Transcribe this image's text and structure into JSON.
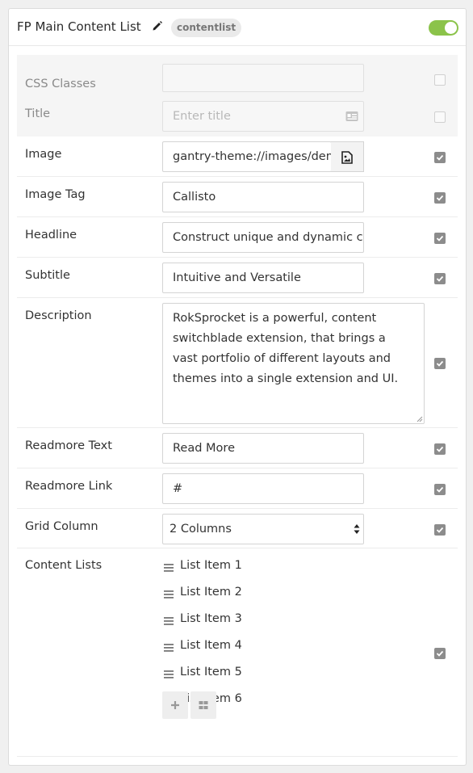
{
  "panel": {
    "title": "FP Main Content List",
    "badge": "contentlist",
    "enabled": true,
    "accent_color": "#8bc34a"
  },
  "fields": {
    "css_classes": {
      "label": "CSS Classes",
      "value": "",
      "checked": false
    },
    "title": {
      "label": "Title",
      "placeholder": "Enter title",
      "checked": false
    },
    "image": {
      "label": "Image",
      "value": "gantry-theme://images/demo/",
      "checked": true
    },
    "image_tag": {
      "label": "Image Tag",
      "value": "Callisto",
      "checked": true
    },
    "headline": {
      "label": "Headline",
      "value": "Construct unique and dynamic content",
      "checked": true
    },
    "subtitle": {
      "label": "Subtitle",
      "value": "Intuitive and Versatile",
      "checked": true
    },
    "description": {
      "label": "Description",
      "value": "RokSprocket is a powerful, content switchblade extension, that brings a vast portfolio of different layouts and themes into a single extension and UI.",
      "checked": true
    },
    "readmore_text": {
      "label": "Readmore Text",
      "value": "Read More",
      "checked": true
    },
    "readmore_link": {
      "label": "Readmore Link",
      "value": "#",
      "checked": true
    },
    "grid_column": {
      "label": "Grid Column",
      "value": "2 Columns",
      "checked": true
    },
    "content_lists": {
      "label": "Content Lists",
      "checked": true,
      "items": [
        "List Item 1",
        "List Item 2",
        "List Item 3",
        "List Item 4",
        "List Item 5",
        "List Item 6"
      ]
    }
  },
  "icons": {
    "edit": "pencil-icon",
    "title_field": "id-card-icon",
    "image_picker": "image-file-icon",
    "list_handle": "hamburger-icon",
    "add": "plus-icon",
    "grid": "grid-icon",
    "select": "select-arrows-icon"
  }
}
